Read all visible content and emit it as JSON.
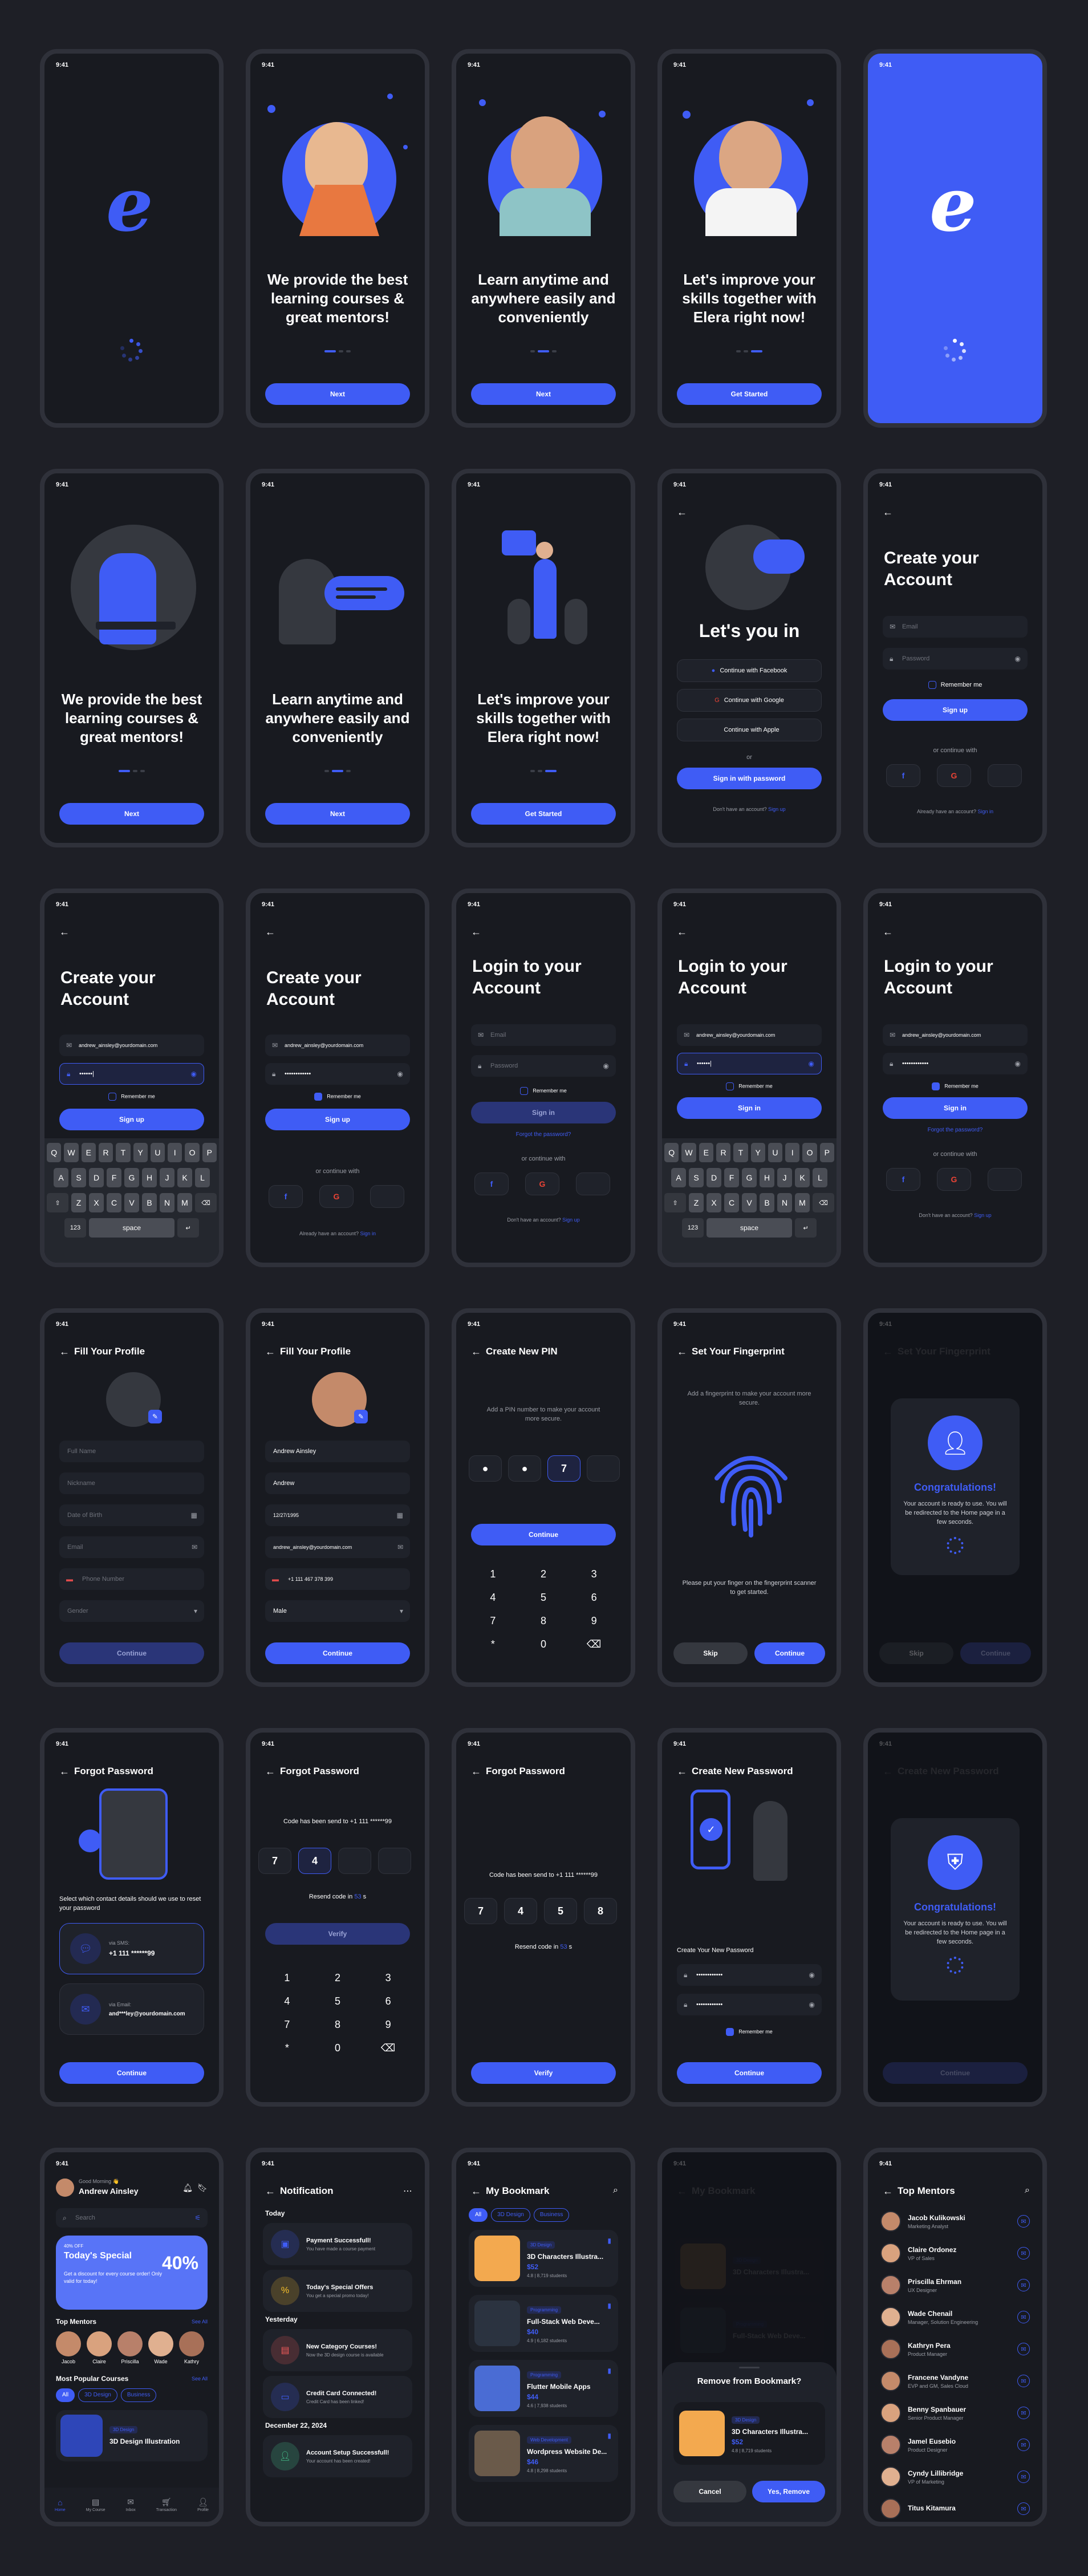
{
  "status_time": "9:41",
  "brand": {
    "logo_letter": "e"
  },
  "onboarding": [
    {
      "text": "We provide the best learning courses & great mentors!",
      "button": "Next"
    },
    {
      "text": "Learn anytime and anywhere easily and conveniently",
      "button": "Next"
    },
    {
      "text": "Let's improve your skills together with Elera right now!",
      "button": "Get Started"
    }
  ],
  "lets_you_in": {
    "title": "Let's you in",
    "facebook": "Continue with Facebook",
    "google": "Continue with Google",
    "apple": "Continue with Apple",
    "or": "or",
    "signin_password": "Sign in with password",
    "no_account": "Don't have an account?",
    "sign_up_link": "Sign up"
  },
  "create_account": {
    "title": "Create your Account",
    "email_placeholder": "Email",
    "password_placeholder": "Password",
    "email_value": "andrew_ainsley@yourdomain.com",
    "password_partial": "••••••|",
    "password_filled": "••••••••••••",
    "remember": "Remember me",
    "signup": "Sign up",
    "or_continue": "or continue with",
    "have_account": "Already have an account?",
    "sign_in_link": "Sign in"
  },
  "login": {
    "title": "Login to your Account",
    "signin": "Sign in",
    "forgot": "Forgot the password?",
    "or_continue": "or continue with",
    "no_account": "Don't have an account?",
    "sign_up_link": "Sign up"
  },
  "keyboard": {
    "row1": [
      "Q",
      "W",
      "E",
      "R",
      "T",
      "Y",
      "U",
      "I",
      "O",
      "P"
    ],
    "row2": [
      "A",
      "S",
      "D",
      "F",
      "G",
      "H",
      "J",
      "K",
      "L"
    ],
    "row3": [
      "Z",
      "X",
      "C",
      "V",
      "B",
      "N",
      "M"
    ],
    "num": "123",
    "space": "space"
  },
  "profile": {
    "title": "Fill Your Profile",
    "full_name_ph": "Full Name",
    "nickname_ph": "Nickname",
    "dob_ph": "Date of Birth",
    "email_ph": "Email",
    "phone_ph": "Phone Number",
    "gender_ph": "Gender",
    "full_name": "Andrew Ainsley",
    "nickname": "Andrew",
    "dob": "12/27/1995",
    "email": "andrew_ainsley@yourdomain.com",
    "phone": "+1 111 467 378 399",
    "gender": "Male",
    "continue": "Continue"
  },
  "pin": {
    "title": "Create New PIN",
    "subtitle": "Add a PIN number to make your account more secure.",
    "digit": "7",
    "continue": "Continue",
    "keys": [
      "1",
      "2",
      "3",
      "4",
      "5",
      "6",
      "7",
      "8",
      "9",
      "*",
      "0",
      "⌫"
    ]
  },
  "fingerprint": {
    "title": "Set Your Fingerprint",
    "subtitle": "Add a fingerprint to make your account more secure.",
    "instruction": "Please put your finger on the fingerprint scanner to get started.",
    "skip": "Skip",
    "continue": "Continue"
  },
  "congrats": {
    "title": "Congratulations!",
    "message": "Your account is ready to use. You will be redirected to the Home page in a few seconds."
  },
  "forgot": {
    "title": "Forgot Password",
    "prompt": "Select which contact details should we use to reset your password",
    "sms_label": "via SMS:",
    "sms_value": "+1 111 ******99",
    "email_label": "via Email:",
    "email_value": "and***ley@yourdomain.com",
    "continue": "Continue",
    "code_sent": "Code has been send to +1 111 ******99",
    "code": [
      "7",
      "4"
    ],
    "code_full": [
      "7",
      "4",
      "5",
      "8"
    ],
    "resend_prefix": "Resend code in",
    "resend_secs": "53",
    "resend_suffix": "s",
    "verify": "Verify"
  },
  "new_password": {
    "title": "Create New Password",
    "label": "Create Your New Password",
    "password": "••••••••••••",
    "remember": "Remember me",
    "continue": "Continue"
  },
  "home": {
    "greeting": "Good Morning 👋",
    "name": "Andrew Ainsley",
    "search_ph": "Search",
    "promo_small": "40% OFF",
    "promo_title": "Today's Special",
    "promo_pct": "40%",
    "promo_desc": "Get a discount for every course order! Only valid for today!",
    "top_mentors": "Top Mentors",
    "see_all": "See All",
    "mentor_names": [
      "Jacob",
      "Claire",
      "Priscilla",
      "Wade",
      "Kathry"
    ],
    "popular": "Most Popular Courses",
    "chips": [
      "All",
      "3D Design",
      "Business"
    ],
    "course_tag": "3D Design",
    "course_name": "3D Design Illustration",
    "nav": [
      "Home",
      "My Course",
      "Inbox",
      "Transaction",
      "Profile"
    ]
  },
  "notifications": {
    "title": "Notification",
    "today": "Today",
    "yesterday": "Yesterday",
    "dec": "December 22, 2024",
    "items": [
      {
        "title": "Payment Successfull!",
        "sub": "You have made a course payment"
      },
      {
        "title": "Today's Special Offers",
        "sub": "You get a special promo today!"
      },
      {
        "title": "New Category Courses!",
        "sub": "Now the 3D design course is available"
      },
      {
        "title": "Credit Card Connected!",
        "sub": "Credit Card has been linked!"
      },
      {
        "title": "Account Setup Successfull!",
        "sub": "Your account has been created!"
      }
    ]
  },
  "bookmark": {
    "title": "My Bookmark",
    "chips": [
      "All",
      "3D Design",
      "Business"
    ],
    "courses": [
      {
        "tag": "3D Design",
        "name": "3D Characters Illustra...",
        "price": "$52",
        "meta": "4.8 | 8,719 students"
      },
      {
        "tag": "Programming",
        "name": "Full-Stack Web Deve...",
        "price": "$40",
        "meta": "4.9 | 6,182 students"
      },
      {
        "tag": "Programming",
        "name": "Flutter Mobile Apps",
        "price": "$44",
        "meta": "4.6 | 7,938 students"
      },
      {
        "tag": "Web Development",
        "name": "Wordpress Website De...",
        "price": "$46",
        "meta": "4.8 | 8,298 students"
      }
    ]
  },
  "remove_bookmark": {
    "title": "Remove from Bookmark?",
    "cancel": "Cancel",
    "confirm": "Yes, Remove"
  },
  "mentors": {
    "title": "Top Mentors",
    "items": [
      {
        "name": "Jacob Kulikowski",
        "role": "Marketing Analyst"
      },
      {
        "name": "Claire Ordonez",
        "role": "VP of Sales"
      },
      {
        "name": "Priscilla Ehrman",
        "role": "UX Designer"
      },
      {
        "name": "Wade Chenail",
        "role": "Manager, Solution Engineering"
      },
      {
        "name": "Kathryn Pera",
        "role": "Product Manager"
      },
      {
        "name": "Francene Vandyne",
        "role": "EVP and GM, Sales Cloud"
      },
      {
        "name": "Benny Spanbauer",
        "role": "Senior Product Manager"
      },
      {
        "name": "Jamel Eusebio",
        "role": "Product Designer"
      },
      {
        "name": "Cyndy Lillibridge",
        "role": "VP of Marketing"
      },
      {
        "name": "Titus Kitamura",
        "role": ""
      }
    ]
  },
  "colors": {
    "accent": "#3f5cf5",
    "bg": "#181a20",
    "card": "#1f222a"
  }
}
